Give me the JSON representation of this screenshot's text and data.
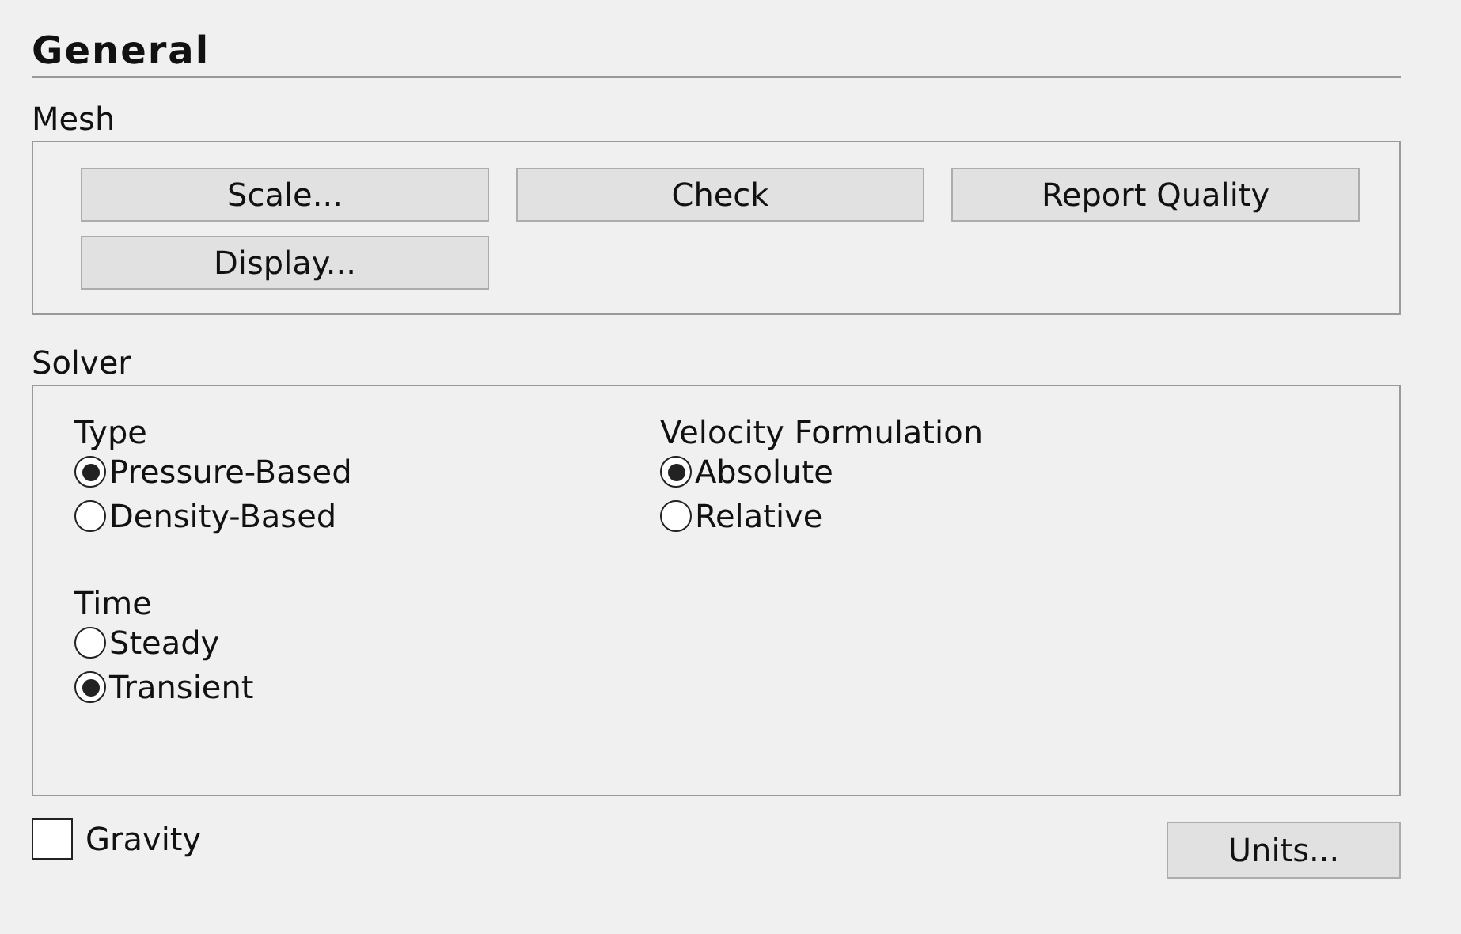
{
  "panel": {
    "title": "General"
  },
  "mesh": {
    "label": "Mesh",
    "buttons": [
      "Scale...",
      "Check",
      "Report Quality",
      "Display..."
    ]
  },
  "solver": {
    "label": "Solver",
    "groups": [
      {
        "label": "Type",
        "options": [
          {
            "label": "Pressure-Based",
            "selected": true
          },
          {
            "label": "Density-Based",
            "selected": false
          }
        ]
      },
      {
        "label": "Velocity Formulation",
        "options": [
          {
            "label": "Absolute",
            "selected": true
          },
          {
            "label": "Relative",
            "selected": false
          }
        ]
      },
      {
        "label": "Time",
        "options": [
          {
            "label": "Steady",
            "selected": false
          },
          {
            "label": "Transient",
            "selected": true
          }
        ]
      }
    ]
  },
  "gravity": {
    "label": "Gravity",
    "checked": false
  },
  "units_button": "Units..."
}
